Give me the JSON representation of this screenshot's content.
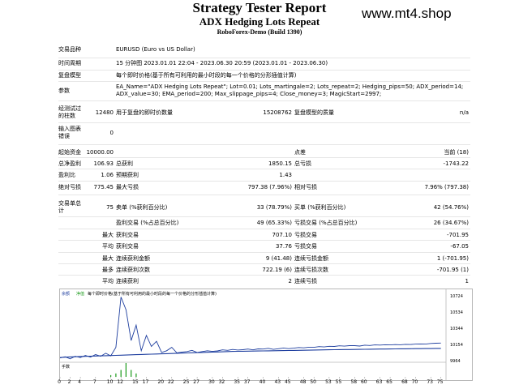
{
  "report": {
    "title": "Strategy Tester Report",
    "subtitle": "ADX Hedging Lots Repeat",
    "server": "RoboForex-Demo (Build 1390)",
    "brand": "www.mt4.shop"
  },
  "info": {
    "symbol_label": "交易品种",
    "symbol_value": "EURUSD (Euro vs US Dollar)",
    "period_label": "时间周期",
    "period_value": "15 分钟图 2023.01.01 22:04 - 2023.06.30 20:59 (2023.01.01 - 2023.06.30)",
    "model_label": "复盘模型",
    "model_value": "每个即时价格(基于所有可利用的最小时段的每一个价格的分形插值计算)",
    "params_label": "参数",
    "params_line1": "EA_Name=\"ADX Hedging Lots Repeat\"; Lot=0.01; Lots_martingale=2; Lots_repeat=2; Hedging_pips=50; ADX_period=14;",
    "params_line2": "ADX_value=30; EMA_period=200; Max_slippage_pips=4; Close_money=3; MagicStart=2997;",
    "bars_label_1": "经测试过",
    "bars_label_2": "的柱数",
    "bars_value": "12480",
    "ticks_label": "用于复盘的即时价数量",
    "ticks_value": "15208762",
    "quality_label": "复盘模型的质量",
    "quality_value": "n/a",
    "errors_label_1": "输入图表",
    "errors_label_2": "错误",
    "errors_value": "0"
  },
  "stats": {
    "initial_deposit_label": "起始资金",
    "initial_deposit_value": "10000.00",
    "spread_label": "点差",
    "spread_value": "当前 (18)",
    "net_profit_label": "总净盈利",
    "net_profit_value": "106.93",
    "gross_profit_label": "总获利",
    "gross_profit_value": "1850.15",
    "gross_loss_label": "总亏损",
    "gross_loss_value": "-1743.22",
    "profit_factor_label": "盈利比",
    "profit_factor_value": "1.06",
    "expected_payoff_label": "预期获利",
    "expected_payoff_value": "1.43",
    "abs_drawdown_label": "绝对亏损",
    "abs_drawdown_value": "775.45",
    "max_drawdown_label": "最大亏损",
    "max_drawdown_value": "797.38 (7.96%)",
    "rel_drawdown_label": "相对亏损",
    "rel_drawdown_value": "7.96% (797.38)",
    "total_trades_label_1": "交易单总",
    "total_trades_label_2": "计",
    "total_trades_value": "75",
    "short_label": "卖单 (%获利百分比)",
    "short_value": "33 (78.79%)",
    "long_label": "买单 (%获利百分比)",
    "long_value": "42 (54.76%)",
    "profit_trades_label": "盈利交易 (%占总百分比)",
    "profit_trades_value": "49 (65.33%)",
    "loss_trades_label": "亏损交易 (%占总百分比)",
    "loss_trades_value": "26 (34.67%)",
    "largest_label": "最大",
    "largest_profit_label": "获利交易",
    "largest_profit_value": "707.10",
    "largest_loss_label": "亏损交易",
    "largest_loss_value": "-701.95",
    "average_label": "平均",
    "average_profit_label": "获利交易",
    "average_profit_value": "37.76",
    "average_loss_label": "亏损交易",
    "average_loss_value": "-67.05",
    "max_label": "最大",
    "max_cons_wins_label": "连续获利金额",
    "max_cons_wins_value": "9 (41.48)",
    "max_cons_losses_label": "连续亏损金额",
    "max_cons_losses_value": "1 (-701.95)",
    "maximal_label": "最多",
    "maximal_cons_profit_label": "连续获利次数",
    "maximal_cons_profit_value": "722.19 (6)",
    "maximal_cons_loss_label": "连续亏损次数",
    "maximal_cons_loss_value": "-701.95 (1)",
    "avg_cons_label": "平均",
    "avg_cons_wins_label": "连续获利",
    "avg_cons_wins_value": "2",
    "avg_cons_losses_label": "连续亏损",
    "avg_cons_losses_value": "1"
  },
  "chart_header": {
    "balance_label": "余额",
    "equity_label": "净值",
    "caption": "每个即时价格(基于所有可利用的最小时段的每一个价格的分形插值计算)",
    "lots_label": "手数"
  },
  "colors": {
    "balance_line": "#1f3f9f",
    "equity_line": "#1f3f9f",
    "lots_bars": "#1a9a1a",
    "axis_text": "#000000"
  },
  "chart_data": {
    "type": "line",
    "series": [
      {
        "name": "余额",
        "x": [
          0,
          1,
          2,
          3,
          4,
          5,
          6,
          7,
          8,
          9,
          10,
          11,
          12,
          13,
          14,
          15,
          16,
          17,
          18,
          19,
          20,
          21,
          22,
          23,
          24,
          25,
          26,
          27,
          28,
          29,
          30,
          31,
          32,
          33,
          34,
          35,
          36,
          37,
          38,
          39,
          40,
          41,
          42,
          43,
          44,
          45,
          46,
          47,
          48,
          49,
          50,
          51,
          52,
          53,
          54,
          55,
          56,
          57,
          58,
          59,
          60,
          61,
          62,
          63,
          64,
          65,
          66,
          67,
          68,
          69,
          70,
          71,
          72,
          73,
          74,
          75
        ],
        "values": [
          10000,
          10005,
          10008,
          10010,
          10012,
          10014,
          10016,
          10018,
          10020,
          10022,
          10024,
          10026,
          10028,
          10030,
          10032,
          10034,
          10036,
          10038,
          10040,
          10042,
          10044,
          10046,
          10048,
          10050,
          10052,
          10054,
          10056,
          10058,
          10060,
          10062,
          10064,
          10066,
          10068,
          10070,
          10072,
          10073,
          10074,
          10075,
          10076,
          10077,
          10078,
          10079,
          10080,
          10081,
          10082,
          10083,
          10084,
          10085,
          10086,
          10087,
          10088,
          10089,
          10090,
          10091,
          10092,
          10093,
          10094,
          10094,
          10095,
          10096,
          10097,
          10098,
          10099,
          10100,
          10100,
          10101,
          10102,
          10103,
          10103,
          10104,
          10105,
          10105,
          10106,
          10106,
          10107,
          10107
        ]
      },
      {
        "name": "净值",
        "x": [
          0,
          1,
          2,
          3,
          4,
          5,
          6,
          7,
          8,
          9,
          10,
          11,
          12,
          13,
          14,
          15,
          16,
          17,
          18,
          19,
          20,
          21,
          22,
          23,
          24,
          25,
          26,
          27,
          28,
          29,
          30,
          31,
          32,
          33,
          34,
          35,
          36,
          37,
          38,
          39,
          40,
          41,
          42,
          43,
          44,
          45,
          46,
          47,
          48,
          49,
          50,
          51,
          52,
          53,
          54,
          55,
          56,
          57,
          58,
          59,
          60,
          61,
          62,
          63,
          64,
          65,
          66,
          67,
          68,
          69,
          70,
          71,
          72,
          73,
          74,
          75
        ],
        "values": [
          9995,
          10010,
          9985,
          10015,
          10000,
          10025,
          10005,
          10035,
          10015,
          10050,
          10020,
          10120,
          10710,
          10560,
          10200,
          10380,
          10080,
          10260,
          10130,
          10190,
          10060,
          10080,
          10120,
          10055,
          10065,
          10070,
          10085,
          10060,
          10070,
          10080,
          10072,
          10078,
          10090,
          10085,
          10095,
          10088,
          10092,
          10100,
          10090,
          10102,
          10100,
          10108,
          10096,
          10104,
          10112,
          10105,
          10110,
          10118,
          10114,
          10122,
          10120,
          10128,
          10125,
          10132,
          10130,
          10138,
          10134,
          10140,
          10140,
          10135,
          10145,
          10142,
          10148,
          10146,
          10150,
          10148,
          10152,
          10150,
          10155,
          10153,
          10158,
          10160,
          10158,
          10165,
          10168,
          10170
        ]
      }
    ],
    "lots": {
      "name": "手数",
      "x": [
        10,
        11,
        12,
        13,
        14,
        15
      ],
      "values": [
        0.01,
        0.02,
        0.04,
        0.08,
        0.04,
        0.02
      ]
    },
    "xticks": [
      0,
      2,
      4,
      7,
      10,
      12,
      15,
      17,
      20,
      22,
      25,
      27,
      30,
      32,
      35,
      37,
      40,
      43,
      45,
      48,
      50,
      53,
      55,
      58,
      60,
      63,
      65,
      68,
      70,
      73,
      75
    ],
    "yticks": [
      "10724",
      "10534",
      "10344",
      "10154",
      "9964"
    ],
    "ylim": [
      9964,
      10724
    ],
    "xlim": [
      0,
      76
    ],
    "grid": false
  }
}
